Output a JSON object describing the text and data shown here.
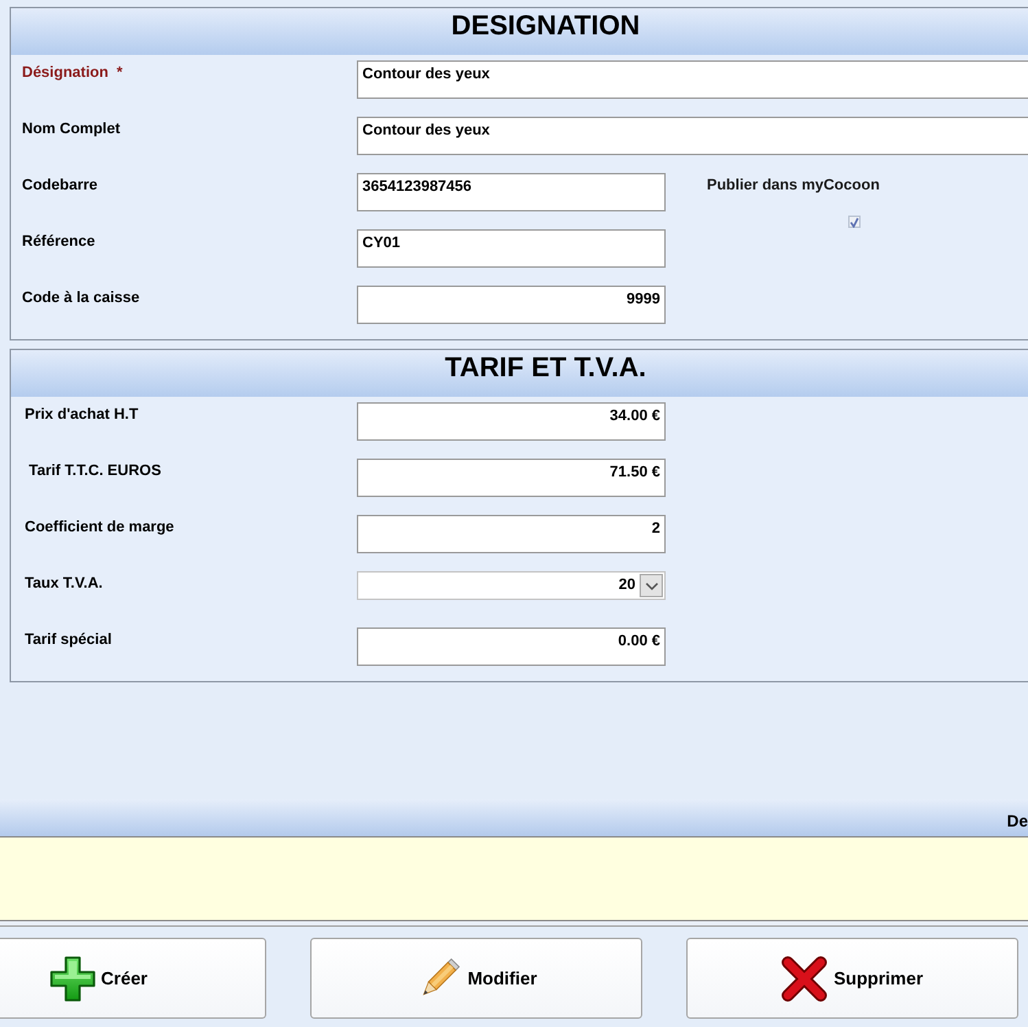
{
  "sections": [
    {
      "title": "DESIGNATION",
      "fields": [
        {
          "kind": "long_text",
          "label": "Désignation  *",
          "required": true,
          "value": "Contour des yeux"
        },
        {
          "kind": "long_text",
          "label": "Nom Complet",
          "required": false,
          "value": "Contour des yeux"
        },
        {
          "kind": "text",
          "label": "Codebarre",
          "required": false,
          "value": "3654123987456"
        },
        {
          "kind": "text",
          "label": "Référence",
          "required": false,
          "value": "CY01"
        },
        {
          "kind": "number",
          "label": "Code à la caisse",
          "required": false,
          "value": "9999"
        }
      ],
      "side_option": {
        "label": "Publier dans myCocoon",
        "checked": true,
        "disabled": true
      }
    },
    {
      "title": "TARIF ET T.V.A.",
      "fields": [
        {
          "kind": "number",
          "label": "Prix d'achat H.T",
          "required": false,
          "value": "34.00 €"
        },
        {
          "kind": "number",
          "label": " Tarif T.T.C. EUROS",
          "required": false,
          "value": "71.50 €"
        },
        {
          "kind": "number",
          "label": "Coefficient de marge",
          "required": false,
          "value": "2"
        },
        {
          "kind": "select",
          "label": "Taux T.V.A.",
          "required": false,
          "value": "20"
        },
        {
          "kind": "number",
          "label": "Tarif spécial",
          "required": false,
          "value": "0.00 €"
        }
      ]
    }
  ],
  "detail_bar": {
    "title": "De"
  },
  "buttons": [
    {
      "kind": "create",
      "label": "Créer"
    },
    {
      "kind": "edit",
      "label": "Modifier"
    },
    {
      "kind": "delete",
      "label": "Supprimer"
    }
  ]
}
